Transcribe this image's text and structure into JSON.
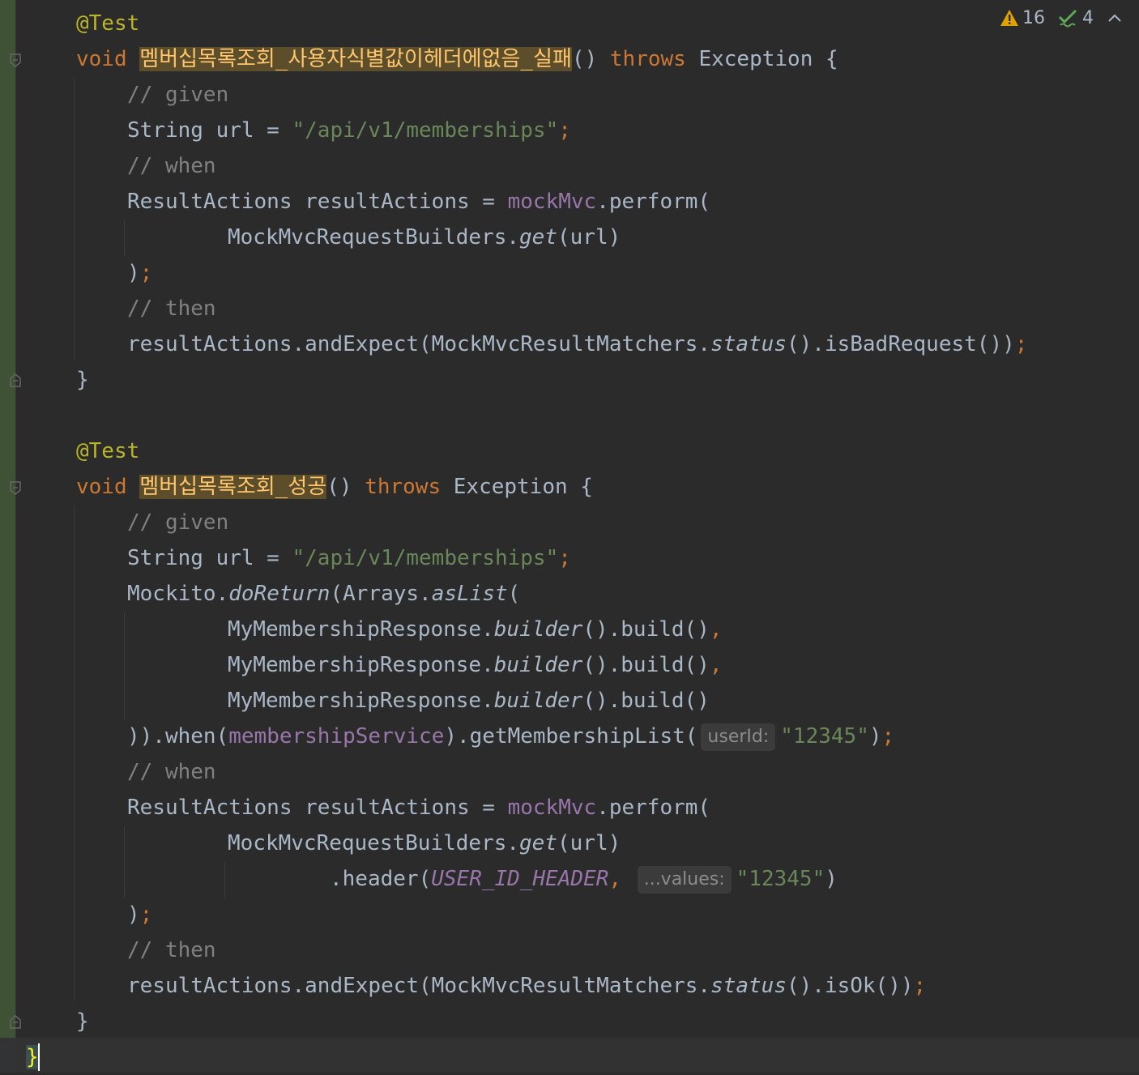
{
  "editor": {
    "inspections": {
      "warnings_count": "16",
      "weak_warnings_count": "4",
      "warning_icon": "warning-triangle-icon",
      "weak_warning_icon": "check-double-icon",
      "collapse_icon": "chevron-up-icon"
    },
    "colors": {
      "background": "#2b2b2b",
      "keyword": "#cc7832",
      "annotation": "#bbb529",
      "string": "#6a8759",
      "comment": "#808080",
      "field": "#9876aa",
      "method_highlight": "#ffc66d",
      "default_text": "#a9b7c6"
    },
    "test1": {
      "annotation": "@Test",
      "void": "void",
      "method_name": "멤버십목록조회_사용자식별값이헤더에없음_실패",
      "paren": "()",
      "throws": "throws",
      "exception": "Exception {",
      "comment_given": "// given",
      "string_type": "String url =",
      "url_literal": "\"/api/v1/memberships\"",
      "semicolon": ";",
      "comment_when": "// when",
      "result_actions_decl": "ResultActions resultActions =",
      "mock_mvc": "mockMvc",
      "perform": ".perform(",
      "request_builder": "MockMvcRequestBuilders.",
      "get": "get",
      "get_args": "(url)",
      "close_paren": ")",
      "comment_then": "// then",
      "expect_prefix": "resultActions.andExpect(MockMvcResultMatchers.",
      "status": "status",
      "expect_suffix": "().isBadRequest())",
      "close_brace": "}"
    },
    "test2": {
      "annotation": "@Test",
      "void": "void",
      "method_name": "멤버십목록조회_성공",
      "paren": "()",
      "throws": "throws",
      "exception": "Exception {",
      "comment_given": "// given",
      "string_type": "String url =",
      "url_literal": "\"/api/v1/memberships\"",
      "semicolon": ";",
      "mockito_prefix": "Mockito.",
      "do_return": "doReturn",
      "arrays_prefix": "(Arrays.",
      "as_list": "asList",
      "open_paren": "(",
      "builder_class": "MyMembershipResponse.",
      "builder": "builder",
      "build_call": "().build()",
      "comma": ",",
      "when_prefix": ")).when(",
      "membership_service": "membershipService",
      "get_membership_list": ").getMembershipList(",
      "user_id_hint": "userId:",
      "user_id_value": "\"12345\"",
      "close_paren": ")",
      "comment_when": "// when",
      "result_actions_decl": "ResultActions resultActions =",
      "mock_mvc": "mockMvc",
      "perform": ".perform(",
      "request_builder": "MockMvcRequestBuilders.",
      "get": "get",
      "get_args": "(url)",
      "header_call": ".header(",
      "user_id_header": "USER_ID_HEADER",
      "values_hint": "...values:",
      "header_value": "\"12345\"",
      "comment_then": "// then",
      "expect_prefix": "resultActions.andExpect(MockMvcResultMatchers.",
      "status": "status",
      "expect_suffix": "().isOk())",
      "close_brace": "}"
    },
    "class_close_brace": "}"
  }
}
